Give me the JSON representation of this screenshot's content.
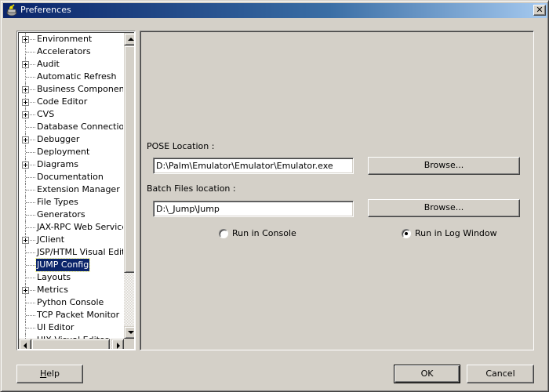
{
  "window": {
    "title": "Preferences",
    "close_label": "✕"
  },
  "tree": {
    "items": [
      {
        "label": "Environment",
        "expandable": true
      },
      {
        "label": "Accelerators",
        "expandable": false
      },
      {
        "label": "Audit",
        "expandable": true
      },
      {
        "label": "Automatic Refresh",
        "expandable": false
      },
      {
        "label": "Business Components",
        "expandable": true
      },
      {
        "label": "Code Editor",
        "expandable": true
      },
      {
        "label": "CVS",
        "expandable": true
      },
      {
        "label": "Database Connections",
        "expandable": false
      },
      {
        "label": "Debugger",
        "expandable": true
      },
      {
        "label": "Deployment",
        "expandable": false
      },
      {
        "label": "Diagrams",
        "expandable": true
      },
      {
        "label": "Documentation",
        "expandable": false
      },
      {
        "label": "Extension Manager",
        "expandable": false
      },
      {
        "label": "File Types",
        "expandable": false
      },
      {
        "label": "Generators",
        "expandable": false
      },
      {
        "label": "JAX-RPC Web Services",
        "expandable": false
      },
      {
        "label": "JClient",
        "expandable": true
      },
      {
        "label": "JSP/HTML Visual Editor",
        "expandable": false
      },
      {
        "label": "JUMP Config",
        "expandable": false,
        "selected": true
      },
      {
        "label": "Layouts",
        "expandable": false
      },
      {
        "label": "Metrics",
        "expandable": true
      },
      {
        "label": "Python Console",
        "expandable": false
      },
      {
        "label": "TCP Packet Monitor",
        "expandable": false
      },
      {
        "label": "UI Editor",
        "expandable": false
      },
      {
        "label": "UIX Visual Editor",
        "expandable": false
      }
    ]
  },
  "config": {
    "pose_label": "POSE Location :",
    "pose_value": "D:\\Palm\\Emulator\\Emulator\\Emulator.exe",
    "batch_label": "Batch Files location :",
    "batch_value": "D:\\_Jump\\Jump",
    "browse_label": "Browse...",
    "run_console_label": "Run in Console",
    "run_log_label": "Run in Log Window",
    "selected_run_mode": "log"
  },
  "footer": {
    "help_label": "Help",
    "help_mnemonic": "H",
    "help_rest": "elp",
    "ok_label": "OK",
    "cancel_label": "Cancel"
  }
}
